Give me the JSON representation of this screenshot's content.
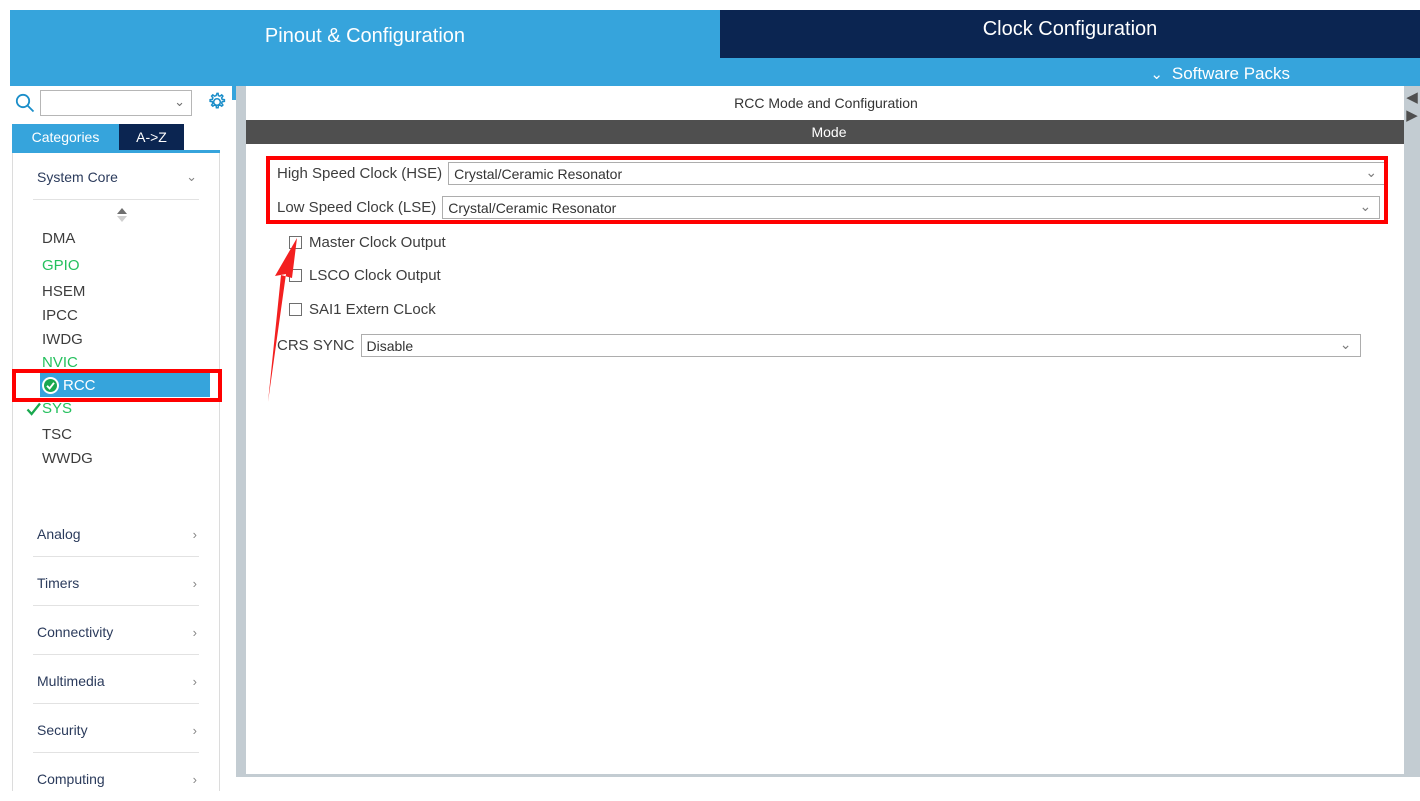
{
  "tabs": {
    "pinout": "Pinout & Configuration",
    "clock": "Clock Configuration",
    "software_packs": "Software Packs",
    "chevron_down": "⌄"
  },
  "sidebar": {
    "search": {
      "placeholder": "",
      "value": "",
      "icon": "search-icon"
    },
    "gear": "gear-icon",
    "view_tabs": [
      {
        "label": "Categories",
        "selected": true
      },
      {
        "label": "A->Z",
        "selected": false
      }
    ],
    "categories": [
      {
        "label": "System Core",
        "expanded": true,
        "chevron": "⌄"
      },
      {
        "label": "Analog",
        "expanded": false,
        "chevron": "›"
      },
      {
        "label": "Timers",
        "expanded": false,
        "chevron": "›"
      },
      {
        "label": "Connectivity",
        "expanded": false,
        "chevron": "›"
      },
      {
        "label": "Multimedia",
        "expanded": false,
        "chevron": "›"
      },
      {
        "label": "Security",
        "expanded": false,
        "chevron": "›"
      },
      {
        "label": "Computing",
        "expanded": false,
        "chevron": "›"
      }
    ],
    "peripherals": [
      {
        "label": "DMA",
        "state": "default",
        "configured": false
      },
      {
        "label": "GPIO",
        "state": "green",
        "configured": false
      },
      {
        "label": "HSEM",
        "state": "default",
        "configured": false
      },
      {
        "label": "IPCC",
        "state": "default",
        "configured": false
      },
      {
        "label": "IWDG",
        "state": "default",
        "configured": false
      },
      {
        "label": "NVIC",
        "state": "green",
        "configured": false
      },
      {
        "label": "RCC",
        "state": "selected",
        "configured": true
      },
      {
        "label": "SYS",
        "state": "green",
        "configured": true
      },
      {
        "label": "TSC",
        "state": "default",
        "configured": false
      },
      {
        "label": "WWDG",
        "state": "default",
        "configured": false
      }
    ]
  },
  "main": {
    "panel_title": "RCC Mode and Configuration",
    "mode_header": "Mode",
    "fields": [
      {
        "label": "High Speed Clock (HSE)",
        "value": "Crystal/Ceramic Resonator",
        "chevron": "⌄"
      },
      {
        "label": "Low Speed Clock (LSE)",
        "value": "Crystal/Ceramic Resonator",
        "chevron": "⌄"
      }
    ],
    "checkboxes": [
      {
        "label": "Master Clock Output",
        "checked": false
      },
      {
        "label": "LSCO Clock Output",
        "checked": false
      },
      {
        "label": "SAI1 Extern CLock",
        "checked": false
      }
    ],
    "crs": {
      "label": "CRS SYNC",
      "value": "Disable",
      "chevron": "⌄"
    }
  },
  "rail": {
    "left_arrow": "◀",
    "right_arrow": "▶"
  },
  "colors": {
    "accent_blue": "#36a4dc",
    "dark_navy": "#0b2551",
    "mode_bar_gray": "#4f4f4f",
    "green": "#25c05e",
    "annotation_red": "#ff0000",
    "panel_border_gray": "#c3ccd2"
  }
}
